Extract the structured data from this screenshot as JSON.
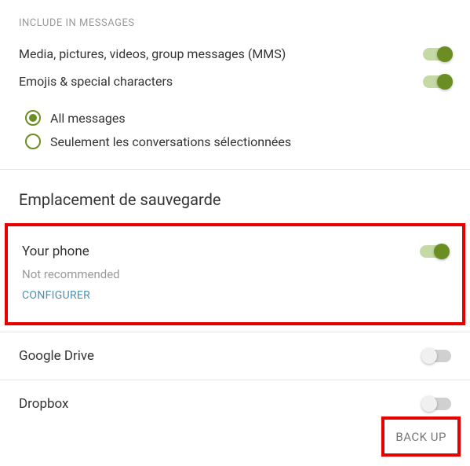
{
  "include_section": {
    "header": "INCLUDE IN MESSAGES",
    "items": [
      {
        "label": "Media, pictures, videos, group messages (MMS)",
        "on": true
      },
      {
        "label": "Emojis & special characters",
        "on": true
      }
    ],
    "radio": {
      "opt1": "All messages",
      "opt2": "Seulement les conversations sélectionnées"
    }
  },
  "location_section": {
    "title": "Emplacement de sauvegarde",
    "your_phone": {
      "label": "Your phone",
      "sub": "Not recommended",
      "link": "CONFIGURER",
      "on": true
    },
    "gdrive": {
      "label": "Google Drive",
      "on": false
    },
    "dropbox": {
      "label": "Dropbox",
      "on": false
    }
  },
  "footer": {
    "backup": "BACK UP"
  }
}
